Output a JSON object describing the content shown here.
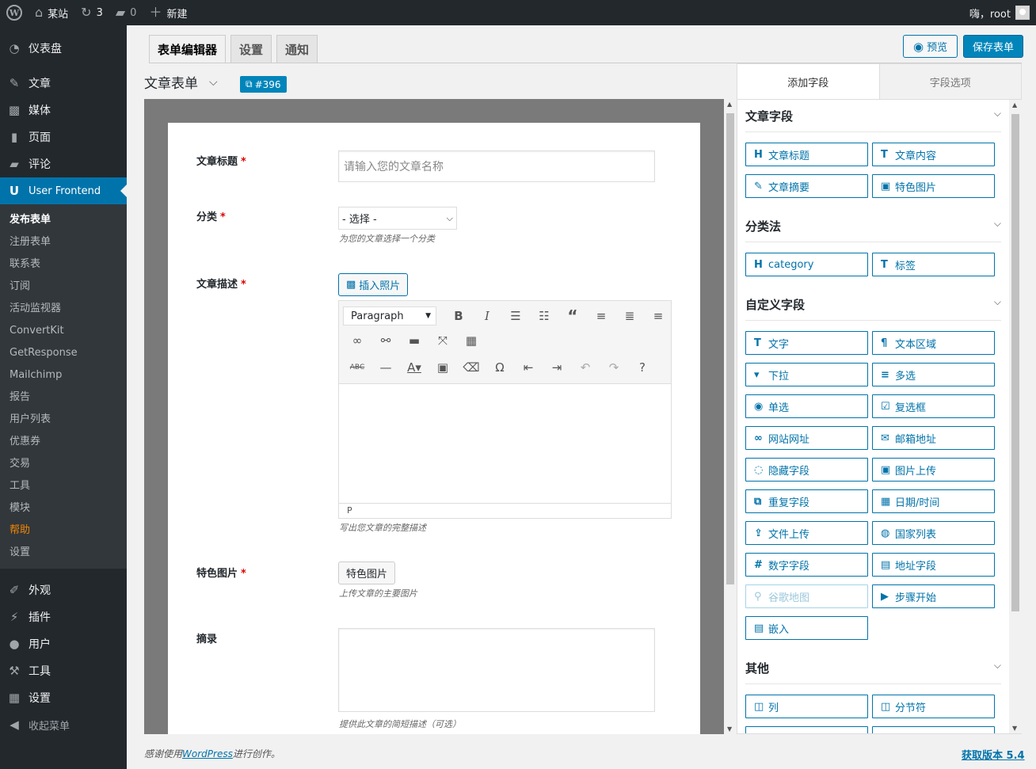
{
  "adminbar": {
    "site_name": "某站",
    "updates_count": "3",
    "comments_count": "0",
    "new_label": "新建",
    "greeting": "嗨，root"
  },
  "sidebar": {
    "items_top": [
      {
        "label": "仪表盘",
        "icon": "dashboard-icon"
      },
      {
        "label": "文章",
        "icon": "pin-icon"
      },
      {
        "label": "媒体",
        "icon": "media-icon"
      },
      {
        "label": "页面",
        "icon": "page-icon"
      },
      {
        "label": "评论",
        "icon": "comment-icon"
      }
    ],
    "active_item": "User Frontend",
    "submenu": [
      "发布表单",
      "注册表单",
      "联系表",
      "订阅",
      "活动监视器",
      "ConvertKit",
      "GetResponse",
      "Mailchimp",
      "报告",
      "用户列表",
      "优惠券",
      "交易",
      "工具",
      "模块",
      "帮助",
      "设置"
    ],
    "items_bottom": [
      {
        "label": "外观",
        "icon": "brush-icon"
      },
      {
        "label": "插件",
        "icon": "plugin-icon"
      },
      {
        "label": "用户",
        "icon": "user-icon"
      },
      {
        "label": "工具",
        "icon": "wrench-icon"
      },
      {
        "label": "设置",
        "icon": "settings-icon"
      }
    ],
    "collapse_label": "收起菜单"
  },
  "tabs": [
    "表单编辑器",
    "设置",
    "通知"
  ],
  "actions": {
    "preview": "预览",
    "save": "保存表单"
  },
  "form": {
    "title": "文章表单",
    "id_badge": "#396",
    "fields": {
      "post_title_label": "文章标题",
      "post_title_placeholder": "请输入您的文章名称",
      "category_label": "分类",
      "category_value": "- 选择 -",
      "category_help": "为您的文章选择一个分类",
      "content_label": "文章描述",
      "insert_photo": "插入照片",
      "paragraph": "Paragraph",
      "status_path": "P",
      "content_help": "写出您文章的完整描述",
      "featured_label": "特色图片",
      "featured_button": "特色图片",
      "featured_help": "上传文章的主要图片",
      "excerpt_label": "摘录",
      "excerpt_help": "提供此文章的简短描述（可选）"
    },
    "required_mark": "*"
  },
  "panel": {
    "tabs": [
      "添加字段",
      "字段选项"
    ],
    "sections": [
      {
        "title": "文章字段",
        "buttons": [
          {
            "label": "文章标题",
            "icon": "H"
          },
          {
            "label": "文章内容",
            "icon": "T"
          },
          {
            "label": "文章摘要",
            "icon": "✎"
          },
          {
            "label": "特色图片",
            "icon": "▣"
          }
        ]
      },
      {
        "title": "分类法",
        "buttons": [
          {
            "label": "category",
            "icon": "H"
          },
          {
            "label": "标签",
            "icon": "T"
          }
        ]
      },
      {
        "title": "自定义字段",
        "buttons": [
          {
            "label": "文字",
            "icon": "T"
          },
          {
            "label": "文本区域",
            "icon": "¶"
          },
          {
            "label": "下拉",
            "icon": "▾"
          },
          {
            "label": "多选",
            "icon": "≡"
          },
          {
            "label": "单选",
            "icon": "◉"
          },
          {
            "label": "复选框",
            "icon": "☑"
          },
          {
            "label": "网站网址",
            "icon": "∞"
          },
          {
            "label": "邮箱地址",
            "icon": "✉"
          },
          {
            "label": "隐藏字段",
            "icon": "◌"
          },
          {
            "label": "图片上传",
            "icon": "▣"
          },
          {
            "label": "重复字段",
            "icon": "⧉"
          },
          {
            "label": "日期/时间",
            "icon": "▦"
          },
          {
            "label": "文件上传",
            "icon": "⇪"
          },
          {
            "label": "国家列表",
            "icon": "◍"
          },
          {
            "label": "数字字段",
            "icon": "#"
          },
          {
            "label": "地址字段",
            "icon": "▤"
          },
          {
            "label": "谷歌地图",
            "icon": "⚲"
          },
          {
            "label": "步骤开始",
            "icon": "▶"
          },
          {
            "label": "嵌入",
            "icon": "▤"
          }
        ]
      },
      {
        "title": "其他",
        "buttons": [
          {
            "label": "列",
            "icon": "◫"
          },
          {
            "label": "分节符",
            "icon": "◫"
          }
        ]
      }
    ]
  },
  "footer": {
    "thanks_prefix": "感谢使用",
    "wordpress": "WordPress",
    "thanks_suffix": "进行创作。",
    "version": "获取版本 5.4"
  }
}
